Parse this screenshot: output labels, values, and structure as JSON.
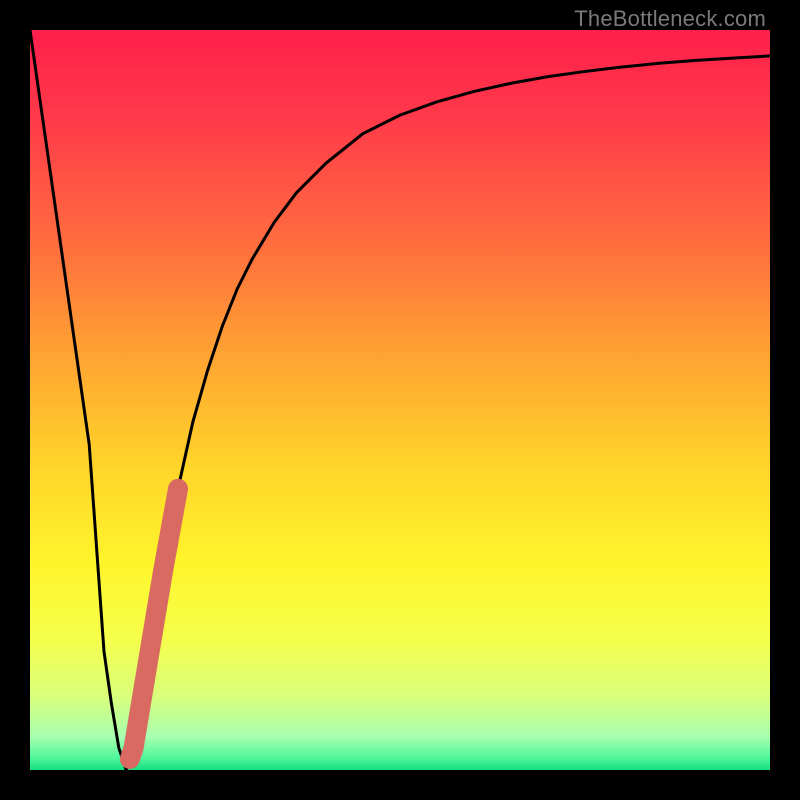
{
  "watermark": "TheBottleneck.com",
  "colors": {
    "frame": "#000000",
    "curve": "#000000",
    "highlight": "#d96a62",
    "gradient_stops": [
      {
        "offset": 0.0,
        "color": "#ff1f4b"
      },
      {
        "offset": 0.12,
        "color": "#ff3a4a"
      },
      {
        "offset": 0.28,
        "color": "#ff6a3f"
      },
      {
        "offset": 0.44,
        "color": "#ffa332"
      },
      {
        "offset": 0.58,
        "color": "#ffd22a"
      },
      {
        "offset": 0.72,
        "color": "#fff52b"
      },
      {
        "offset": 0.82,
        "color": "#f6ff4a"
      },
      {
        "offset": 0.9,
        "color": "#d9ff7a"
      },
      {
        "offset": 0.955,
        "color": "#a8ffb0"
      },
      {
        "offset": 0.985,
        "color": "#4cf59a"
      },
      {
        "offset": 1.0,
        "color": "#13e07e"
      }
    ]
  },
  "chart_data": {
    "type": "line",
    "title": "",
    "xlabel": "",
    "ylabel": "",
    "xlim": [
      0,
      100
    ],
    "ylim": [
      0,
      100
    ],
    "series": [
      {
        "name": "curve",
        "x": [
          0,
          2,
          4,
          6,
          8,
          10,
          11,
          12,
          13,
          14,
          15,
          16,
          18,
          20,
          22,
          24,
          26,
          28,
          30,
          33,
          36,
          40,
          45,
          50,
          55,
          60,
          65,
          70,
          75,
          80,
          85,
          90,
          95,
          100
        ],
        "y": [
          100,
          86,
          72,
          58,
          44,
          16,
          9,
          3,
          0,
          3,
          9,
          15,
          27,
          38,
          47,
          54,
          60,
          65,
          69,
          74,
          78,
          82,
          86,
          88.5,
          90.3,
          91.7,
          92.8,
          93.7,
          94.4,
          95.0,
          95.5,
          95.9,
          96.2,
          96.5
        ]
      }
    ],
    "highlight_segment": {
      "series": "curve",
      "x_range": [
        13.5,
        20
      ],
      "note": "thick rounded highlight near the minimum and rising branch"
    },
    "minimum_x": 13
  }
}
